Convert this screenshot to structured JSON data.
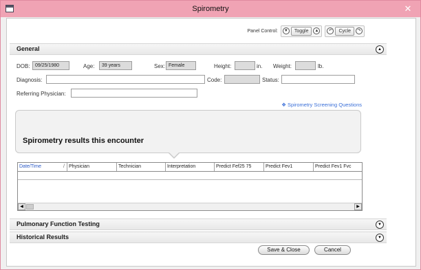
{
  "window": {
    "title": "Spirometry",
    "close_glyph": "✕"
  },
  "panel_control": {
    "label": "Panel Control:",
    "toggle_label": "Toggle",
    "cycle_label": "Cycle",
    "icons": [
      "collapse-icon",
      "expand-icon",
      "rotate-left-icon",
      "rotate-right-icon"
    ]
  },
  "general": {
    "header": "General",
    "dob_label": "DOB:",
    "dob_value": "09/25/1980",
    "age_label": "Age:",
    "age_value": "39 years",
    "sex_label": "Sex:",
    "sex_value": "Female",
    "height_label": "Height:",
    "height_value": "",
    "height_unit": "in.",
    "weight_label": "Weight:",
    "weight_value": "",
    "weight_unit": "lb.",
    "diagnosis_label": "Diagnosis:",
    "diagnosis_value": "",
    "code_label": "Code:",
    "code_value": "",
    "status_label": "Status:",
    "status_value": "",
    "referring_label": "Referring Physician:",
    "referring_value": "",
    "screening_link": "Spirometry Screening Questions",
    "link_glyph": "❖"
  },
  "results": {
    "title": "Spirometry results this encounter",
    "columns": [
      "Date/Time",
      "Physician",
      "Technician",
      "Interpretation",
      "Predict Fef25 75",
      "Predict Fev1",
      "Predict Fev1 Fvc"
    ],
    "sort_indicator": "/"
  },
  "sections": {
    "pulmonary": "Pulmonary Function Testing",
    "historical": "Historical Results"
  },
  "buttons": {
    "save_close": "Save & Close",
    "cancel": "Cancel"
  },
  "colors": {
    "titlebar": "#f0a3b4",
    "link": "#3a6fd8",
    "sorted_column": "#2a59c5"
  }
}
